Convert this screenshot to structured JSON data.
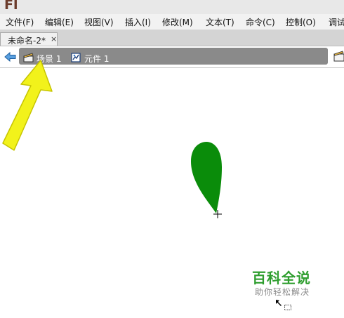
{
  "app": {
    "logo_text": "Fl"
  },
  "menu": {
    "items": [
      {
        "label": "文件(F)"
      },
      {
        "label": "编辑(E)"
      },
      {
        "label": "视图(V)"
      },
      {
        "label": "插入(I)"
      },
      {
        "label": "修改(M)"
      },
      {
        "label": "文本(T)"
      },
      {
        "label": "命令(C)"
      },
      {
        "label": "控制(O)"
      },
      {
        "label": "调试"
      }
    ]
  },
  "document": {
    "tab_label": "未命名-2*",
    "close_glyph": "×"
  },
  "breadcrumb": {
    "scene_label": "场景 1",
    "symbol_label": "元件 1"
  },
  "stage": {
    "shape": {
      "kind": "teardrop",
      "fill": "#0a8c0a"
    },
    "annotation_arrow_color": "#f2f21b"
  },
  "watermark": {
    "title": "百科全说",
    "subtitle": "助你轻松解决"
  },
  "colors": {
    "accent_green": "#2f9e2f",
    "editbar_bg": "#8a8a8a",
    "logo": "#6b3b2b"
  }
}
